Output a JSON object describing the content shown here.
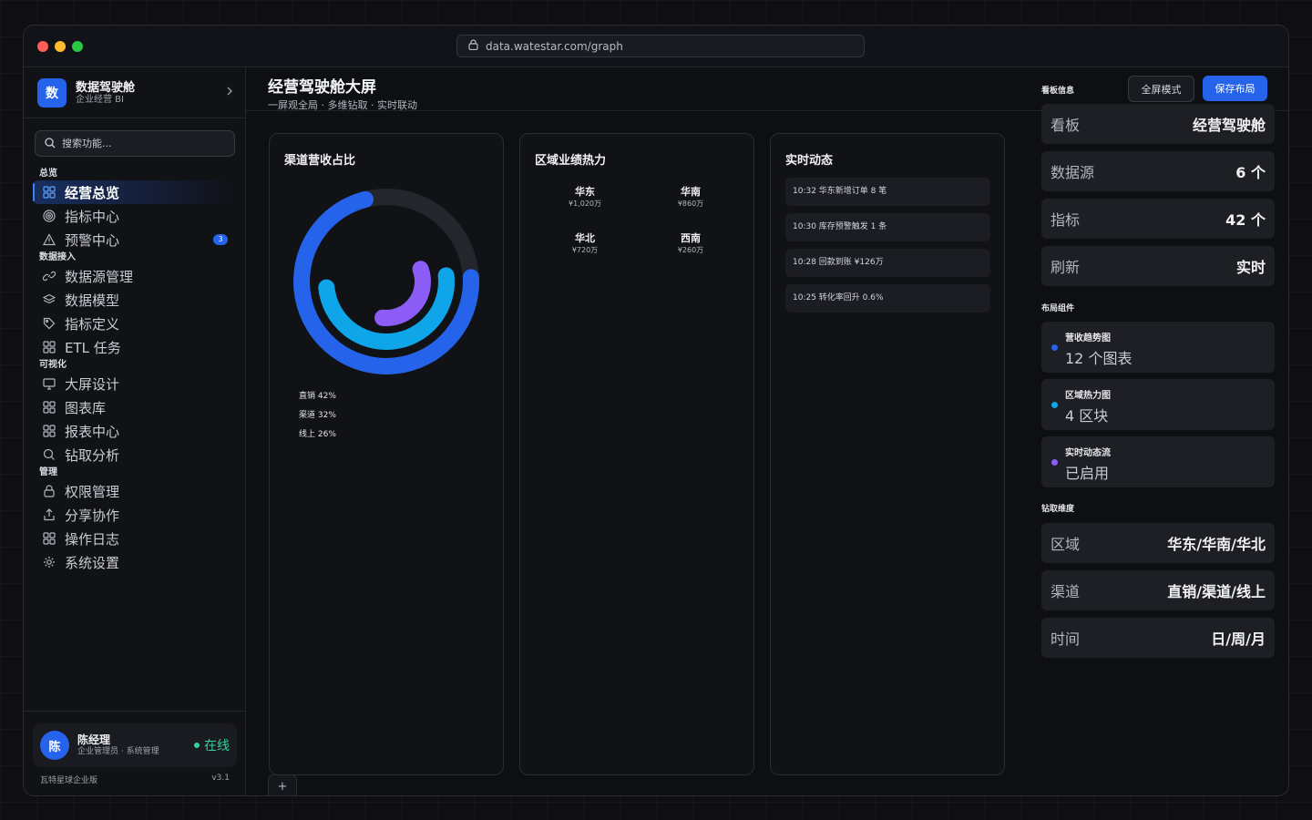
{
  "browser": {
    "url": "data.watestar.com/graph"
  },
  "sidebar": {
    "brand": {
      "logo": "数",
      "title": "数据驾驶舱",
      "subtitle": "企业经营 BI"
    },
    "search_placeholder": "搜索功能...",
    "sections": [
      {
        "title": "总览",
        "items": [
          {
            "label": "经营总览",
            "icon": "grid-icon",
            "active": true
          },
          {
            "label": "指标中心",
            "icon": "target-icon"
          },
          {
            "label": "预警中心",
            "icon": "alert-triangle-icon",
            "badge": "3"
          }
        ]
      },
      {
        "title": "数据接入",
        "items": [
          {
            "label": "数据源管理",
            "icon": "link-icon"
          },
          {
            "label": "数据模型",
            "icon": "layers-icon"
          },
          {
            "label": "指标定义",
            "icon": "tag-icon"
          },
          {
            "label": "ETL 任务",
            "icon": "grid-icon"
          }
        ]
      },
      {
        "title": "可视化",
        "items": [
          {
            "label": "大屏设计",
            "icon": "monitor-icon"
          },
          {
            "label": "图表库",
            "icon": "grid-icon"
          },
          {
            "label": "报表中心",
            "icon": "grid-icon"
          },
          {
            "label": "钻取分析",
            "icon": "search-icon"
          }
        ]
      },
      {
        "title": "管理",
        "items": [
          {
            "label": "权限管理",
            "icon": "lock-icon"
          },
          {
            "label": "分享协作",
            "icon": "share-icon"
          },
          {
            "label": "操作日志",
            "icon": "grid-icon"
          },
          {
            "label": "系统设置",
            "icon": "gear-icon"
          }
        ]
      }
    ],
    "user": {
      "avatar": "陈",
      "name": "陈经理",
      "role": "企业管理员 · 系统管理",
      "status": "在线"
    },
    "footer": {
      "edition": "瓦特星球企业版",
      "version": "v3.1"
    }
  },
  "header": {
    "title": "经营驾驶舱大屏",
    "subtitle": "一屏观全局 · 多维钻取 · 实时联动",
    "fullscreen_label": "全屏模式",
    "save_label": "保存布局"
  },
  "panels": {
    "channel": {
      "title": "渠道营收占比"
    },
    "region": {
      "title": "区域业绩热力"
    },
    "feed": {
      "title": "实时动态",
      "items": [
        "10:32 华东新增订单 8 笔",
        "10:30 库存预警触发 1 条",
        "10:28 回款到账 ¥126万",
        "10:25 转化率回升 0.6%"
      ]
    }
  },
  "chart_data": [
    {
      "type": "pie",
      "chart_style": "radial-donut",
      "categories": [
        "直销",
        "渠道",
        "线上"
      ],
      "values": [
        42,
        32,
        26
      ],
      "unit": "%",
      "legend": [
        "直销 42%",
        "渠道 32%",
        "线上 26%"
      ],
      "colors": [
        "#2563eb",
        "#0ea5e9",
        "#8b5cf6"
      ]
    },
    {
      "type": "heatmap",
      "cells": [
        {
          "name": "华东",
          "value": 1020,
          "label": "¥1,020万"
        },
        {
          "name": "华南",
          "value": 860,
          "label": "¥860万"
        },
        {
          "name": "华北",
          "value": 720,
          "label": "¥720万"
        },
        {
          "name": "西南",
          "value": 260,
          "label": "¥260万"
        }
      ]
    }
  ],
  "right_panel": {
    "info_title": "看板信息",
    "info": [
      {
        "key": "看板",
        "value": "经营驾驶舱"
      },
      {
        "key": "数据源",
        "value": "6 个"
      },
      {
        "key": "指标",
        "value": "42 个"
      },
      {
        "key": "刷新",
        "value": "实时"
      }
    ],
    "components_title": "布局组件",
    "components": [
      {
        "name": "营收趋势图",
        "value": "12 个图表",
        "color": "#2563eb"
      },
      {
        "name": "区域热力图",
        "value": "4 区块",
        "color": "#0ea5e9"
      },
      {
        "name": "实时动态流",
        "value": "已启用",
        "color": "#8b5cf6"
      }
    ],
    "drill_title": "钻取维度",
    "drill": [
      {
        "key": "区域",
        "value": "华东/华南/华北"
      },
      {
        "key": "渠道",
        "value": "直销/渠道/线上"
      },
      {
        "key": "时间",
        "value": "日/周/月"
      }
    ]
  },
  "add_tab_label": "+"
}
